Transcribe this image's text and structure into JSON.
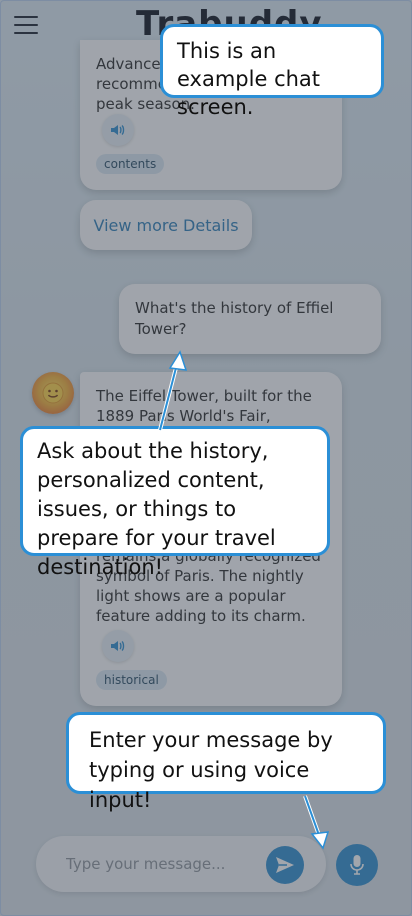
{
  "app": {
    "title": "Trabuddy"
  },
  "messages": {
    "top_bubble_text": "Advance reservations are recommended during the peak season.",
    "top_tag": "contents",
    "details_button": "View more Details",
    "user_question": "What's the history of Effiel Tower?",
    "bot_text_top": "The Eiffel Tower, built for the 1889 Paris World's Fair, initially",
    "bot_text_bottom": "remains a globally recognized symbol of Paris.  The nightly light shows are a popular feature adding to its charm.",
    "bot_tag": "historical"
  },
  "input": {
    "placeholder": "Type your message..."
  },
  "callouts": {
    "chat_screen": "This is an example chat screen.",
    "ask_about": "Ask about the history, personalized content, issues, or things to prepare for your travel destination!",
    "enter_message": "Enter your message by typing or using voice input!"
  },
  "icons": {
    "menu": "hamburger-icon",
    "sound": "speaker-icon",
    "send": "send-icon",
    "mic": "microphone-icon",
    "avatar": "smiley-icon"
  },
  "colors": {
    "accent": "#2f8fd0",
    "callout_border": "#2b8fd6"
  }
}
